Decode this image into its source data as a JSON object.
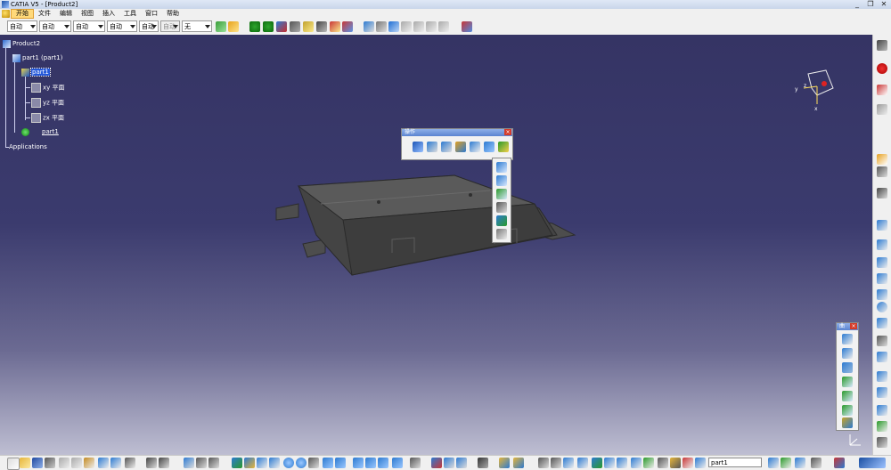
{
  "window": {
    "title": "CATIA V5 - [Product2]",
    "minimize": "_",
    "restore": "❐",
    "close": "✕"
  },
  "menu": {
    "items": [
      "开始",
      "文件",
      "编辑",
      "视图",
      "插入",
      "工具",
      "窗口",
      "帮助"
    ]
  },
  "toolbar": {
    "combos": [
      {
        "value": "自动"
      },
      {
        "value": "自动"
      },
      {
        "value": "自动"
      },
      {
        "value": "自动"
      },
      {
        "value": "自动"
      },
      {
        "value": "自动"
      },
      {
        "value": "无"
      }
    ]
  },
  "tree": {
    "root": "Product2",
    "part_instance": "part1 (part1)",
    "part": "part1",
    "planes": [
      "xy 平面",
      "yz 平面",
      "zx 平面"
    ],
    "body": "part1",
    "applications": "Applications"
  },
  "operations_panel": {
    "title": "操作"
  },
  "small_panel": {
    "title": "曲"
  },
  "compass": {
    "x": "x",
    "y": "y",
    "z": "z"
  },
  "command_field": {
    "value": "part1"
  },
  "colors": {
    "viewport_top": "#353464",
    "viewport_bottom": "#bebed2",
    "model": "#4a4a4a",
    "selection": "#2458d9"
  }
}
